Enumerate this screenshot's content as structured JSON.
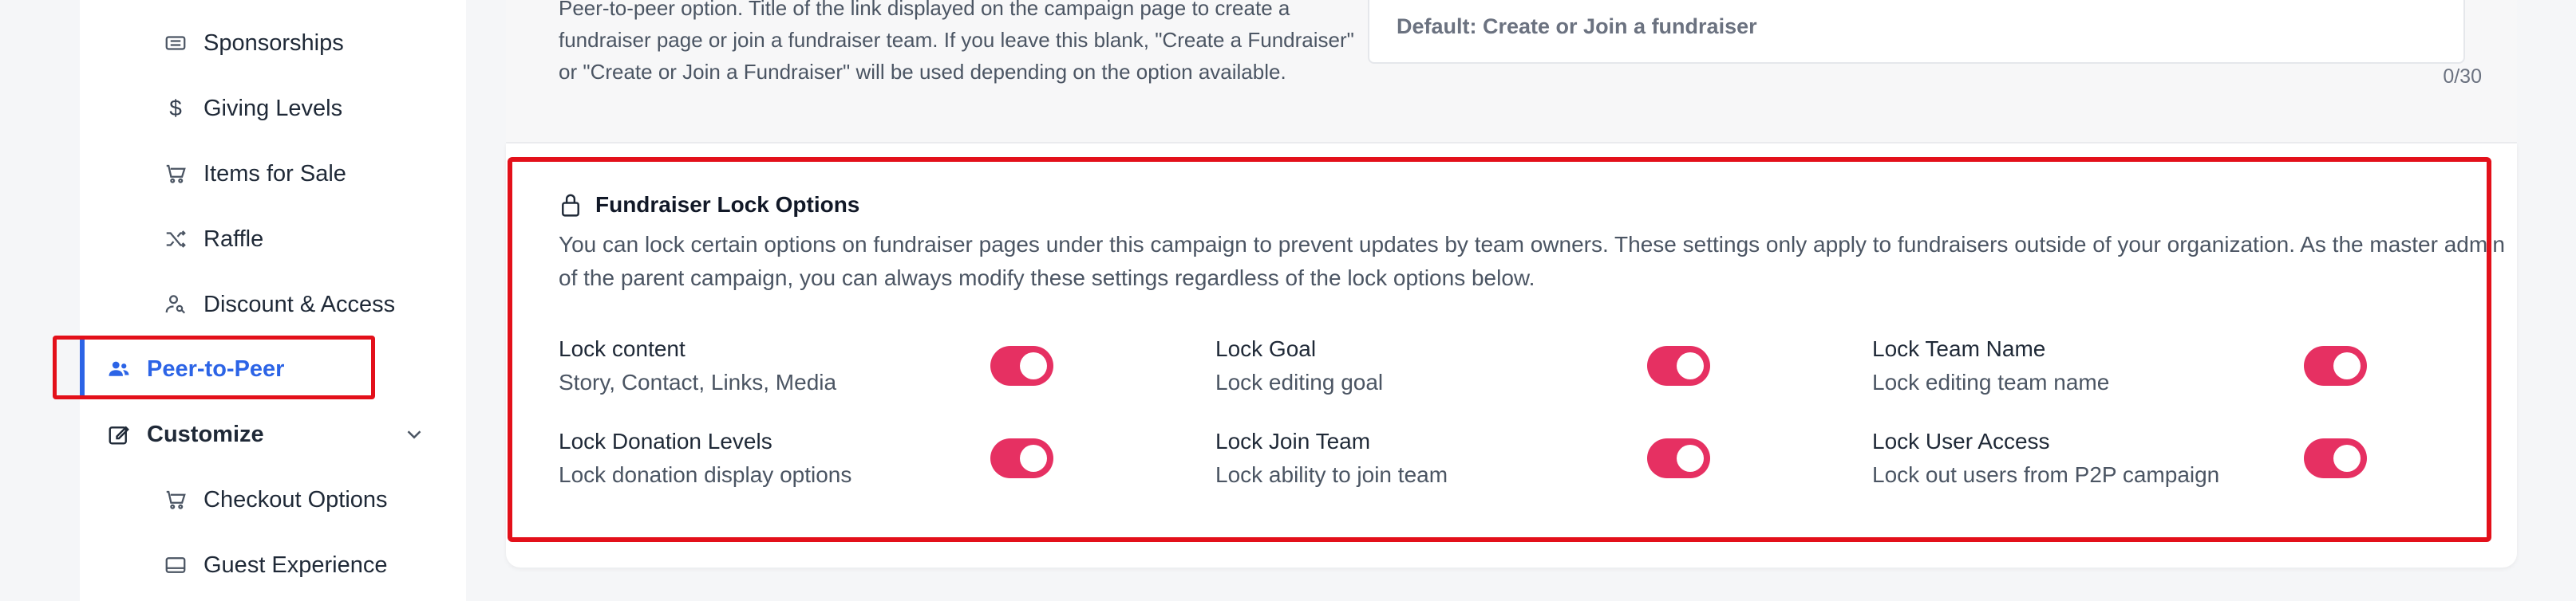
{
  "sidebar": {
    "items": [
      {
        "label": "Sponsorships",
        "icon": "ticket-icon"
      },
      {
        "label": "Giving Levels",
        "icon": "dollar-icon"
      },
      {
        "label": "Items for Sale",
        "icon": "cart-icon"
      },
      {
        "label": "Raffle",
        "icon": "shuffle-icon"
      },
      {
        "label": "Discount & Access",
        "icon": "user-key-icon"
      },
      {
        "label": "Peer-to-Peer",
        "icon": "users-icon",
        "active": true
      },
      {
        "label": "Customize",
        "icon": "edit-icon",
        "section": true
      },
      {
        "label": "Checkout Options",
        "icon": "cart-icon"
      },
      {
        "label": "Guest Experience",
        "icon": "card-icon"
      }
    ]
  },
  "upper": {
    "description": "Peer-to-peer option. Title of the link displayed on the campaign page to create a fundraiser page or join a fundraiser team. If you leave this blank, \"Create a Fundraiser\" or \"Create or Join a Fundraiser\" will be used depending on the option available.",
    "default_value": "Default: Create or Join a fundraiser",
    "counter": "0/30"
  },
  "lock": {
    "title": "Fundraiser Lock Options",
    "description": "You can lock certain options on fundraiser pages under this campaign to prevent updates by team owners. These settings only apply to fundraisers outside of your organization. As the master admin of the parent campaign, you can always modify these settings regardless of the lock options below.",
    "options": [
      {
        "title": "Lock content",
        "subtitle": "Story, Contact, Links, Media",
        "enabled": true
      },
      {
        "title": "Lock Goal",
        "subtitle": "Lock editing goal",
        "enabled": true
      },
      {
        "title": "Lock Team Name",
        "subtitle": "Lock editing team name",
        "enabled": true
      },
      {
        "title": "Lock Donation Levels",
        "subtitle": "Lock donation display options",
        "enabled": true
      },
      {
        "title": "Lock Join Team",
        "subtitle": "Lock ability to join team",
        "enabled": true
      },
      {
        "title": "Lock User Access",
        "subtitle": "Lock out users from P2P campaign",
        "enabled": true
      }
    ]
  },
  "colors": {
    "accent": "#2c64e6",
    "toggle_on": "#e63062",
    "highlight": "#e3101a"
  }
}
